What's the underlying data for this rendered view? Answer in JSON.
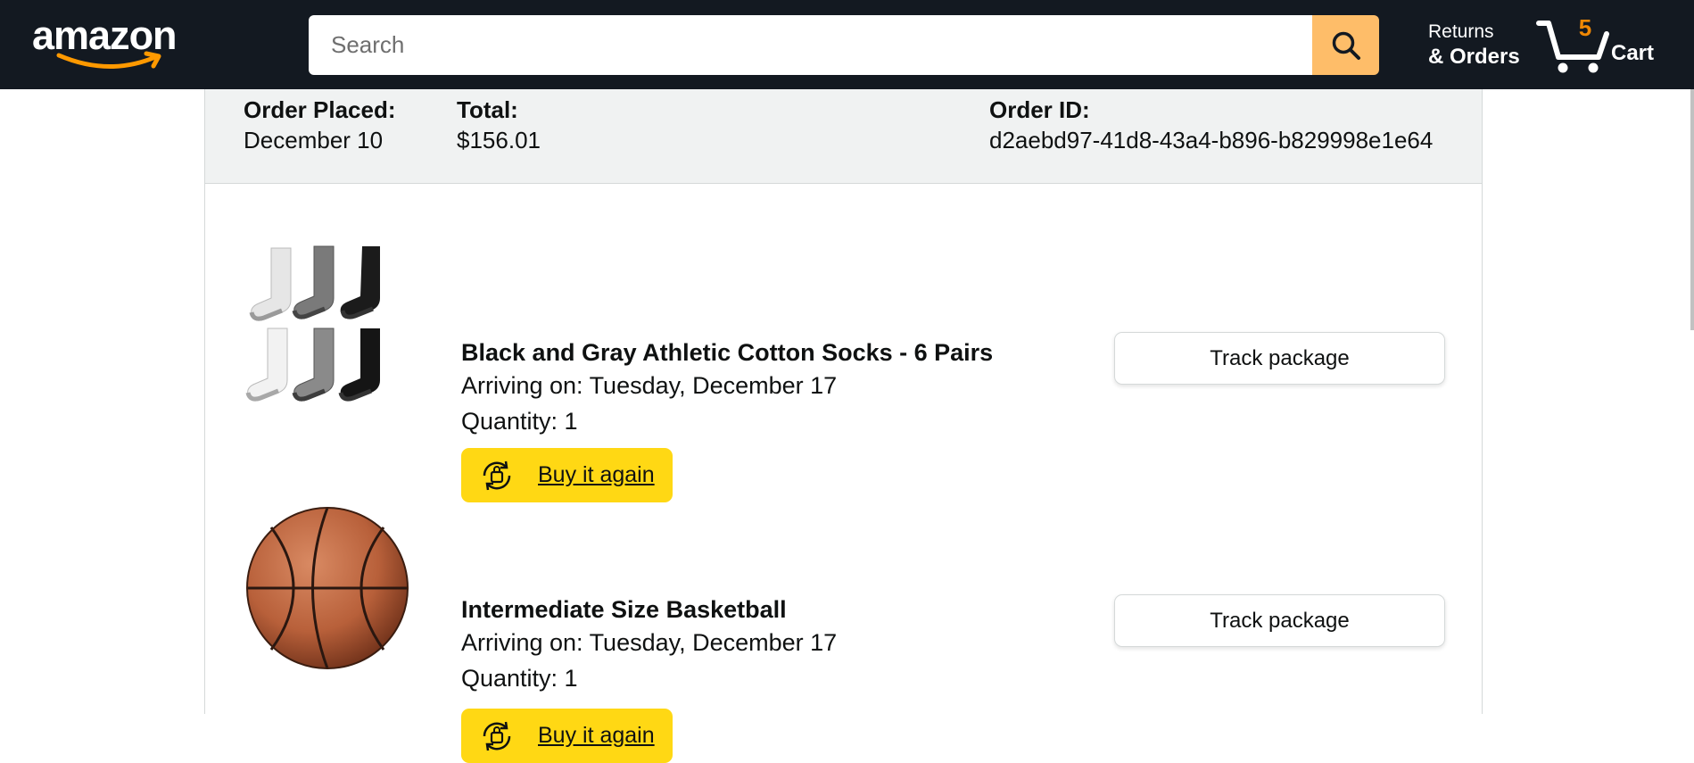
{
  "header": {
    "logo_text": "amazon",
    "search_placeholder": "Search",
    "returns_line1": "Returns",
    "returns_line2": "& Orders",
    "cart_count": "5",
    "cart_label": "Cart",
    "colors": {
      "bar": "#131921",
      "search_button": "#febd69",
      "cart_count": "#f08804",
      "logo_smile": "#ff9900"
    }
  },
  "order": {
    "placed_label": "Order Placed:",
    "placed_value": "December 10",
    "total_label": "Total:",
    "total_value": "$156.01",
    "id_label": "Order ID:",
    "id_value": "d2aebd97-41d8-43a4-b896-b829998e1e64",
    "items": [
      {
        "title": "Black and Gray Athletic Cotton Socks - 6 Pairs",
        "arriving": "Arriving on: Tuesday, December 17",
        "quantity": "Quantity: 1",
        "buy_again": "Buy it again",
        "track": "Track package",
        "image_icon": "socks-image"
      },
      {
        "title": "Intermediate Size Basketball",
        "arriving": "Arriving on: Tuesday, December 17",
        "quantity": "Quantity: 1",
        "buy_again": "Buy it again",
        "track": "Track package",
        "image_icon": "basketball-image"
      }
    ]
  }
}
